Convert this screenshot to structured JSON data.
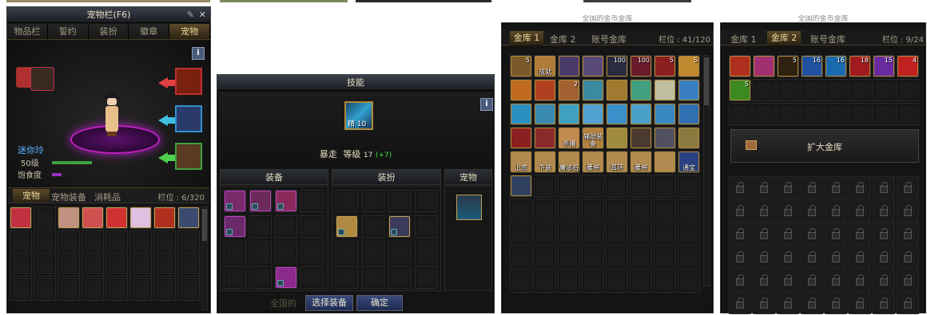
{
  "pet_window": {
    "title": "宠物栏(F6)",
    "tabs": [
      "物品栏",
      "誓约",
      "装扮",
      "徽章",
      "宠物"
    ],
    "active_tab": 4,
    "info": "i",
    "pet_name": "迷你玲",
    "level": "50级",
    "satiety_label": "饱食度",
    "subtabs": [
      "宠物",
      "宠物装备",
      "消耗品"
    ],
    "capacity": "栏位 : 6/320"
  },
  "skill_window": {
    "title": "技能",
    "info": "i",
    "skill_label": "精 10",
    "skill_line": {
      "name": "暴走",
      "level_label": "等级",
      "level": "17",
      "bonus": "(+7)"
    },
    "sections": [
      "装备",
      "装扮",
      "宠物"
    ],
    "select_button": "选择装备",
    "confirm_button": "确定",
    "bg_text": "全国的"
  },
  "vault1": {
    "title": "全国的金币金库",
    "tabs": [
      "金库 1",
      "金库 2",
      "账号金库"
    ],
    "active_tab": 0,
    "capacity": "栏位 : 41/120",
    "items": [
      {
        "c": "#7a5a2a",
        "n": "5",
        "t": ""
      },
      {
        "c": "#b07a3a",
        "n": "",
        "t": "成就"
      },
      {
        "c": "#4a3a6a",
        "n": "",
        "t": ""
      },
      {
        "c": "#5a4a7a",
        "n": "",
        "t": ""
      },
      {
        "c": "#2a2a40",
        "n": "100",
        "t": ""
      },
      {
        "c": "#6a1a2a",
        "n": "100",
        "t": ""
      },
      {
        "c": "#8a2020",
        "n": "5",
        "t": ""
      },
      {
        "c": "#c08a30",
        "n": "5",
        "t": ""
      },
      {
        "c": "#c06a20",
        "n": "",
        "t": ""
      },
      {
        "c": "#b04020",
        "n": "",
        "t": ""
      },
      {
        "c": "#a06030",
        "n": "2",
        "t": ""
      },
      {
        "c": "#3a8aa0",
        "n": "",
        "t": ""
      },
      {
        "c": "#a07a30",
        "n": "",
        "t": ""
      },
      {
        "c": "#40a080",
        "n": "",
        "t": ""
      },
      {
        "c": "#c0c0a0",
        "n": "",
        "t": ""
      },
      {
        "c": "#3a80c0",
        "n": "",
        "t": ""
      },
      {
        "c": "#2a90c0",
        "n": "",
        "t": ""
      },
      {
        "c": "#3a8ab0",
        "n": "",
        "t": ""
      },
      {
        "c": "#40a0c0",
        "n": "",
        "t": ""
      },
      {
        "c": "#50a0d0",
        "n": "",
        "t": ""
      },
      {
        "c": "#3a90c8",
        "n": "",
        "t": ""
      },
      {
        "c": "#4aa0c8",
        "n": "",
        "t": ""
      },
      {
        "c": "#3a88c0",
        "n": "",
        "t": ""
      },
      {
        "c": "#3070b0",
        "n": "",
        "t": ""
      },
      {
        "c": "#8a2020",
        "n": "",
        "t": ""
      },
      {
        "c": "#8a2a2a",
        "n": "",
        "t": ""
      },
      {
        "c": "#c08a50",
        "n": "",
        "t": "手镯"
      },
      {
        "c": "#b08040",
        "n": "",
        "t": "辅助装备"
      },
      {
        "c": "#a08a40",
        "n": "",
        "t": ""
      },
      {
        "c": "#4a3a30",
        "n": "",
        "t": ""
      },
      {
        "c": "#505060",
        "n": "",
        "t": ""
      },
      {
        "c": "#8a7a40",
        "n": "",
        "t": ""
      },
      {
        "c": "#b08a50",
        "n": "",
        "t": "上衣"
      },
      {
        "c": "#b08a50",
        "n": "",
        "t": "下装"
      },
      {
        "c": "#b08a50",
        "n": "",
        "t": "魔法石"
      },
      {
        "c": "#b08a50",
        "n": "",
        "t": "腰带"
      },
      {
        "c": "#b08a50",
        "n": "",
        "t": "耳环"
      },
      {
        "c": "#b08a50",
        "n": "",
        "t": "腰带"
      },
      {
        "c": "#b08a50",
        "n": "",
        "t": ""
      },
      {
        "c": "#2a4080",
        "n": "",
        "t": "通宝"
      },
      {
        "c": "#304060",
        "n": "",
        "t": ""
      }
    ]
  },
  "vault2": {
    "title": "全国的金币金库",
    "tabs": [
      "金库 1",
      "金库 2",
      "账号金库"
    ],
    "active_tab": 1,
    "capacity": "栏位 : 9/24",
    "expand_button": "扩大金库",
    "items": [
      {
        "c": "#b03020",
        "n": "",
        "t": ""
      },
      {
        "c": "#a03070",
        "n": "",
        "t": ""
      },
      {
        "c": "#302010",
        "n": "5",
        "t": ""
      },
      {
        "c": "#2050a0",
        "n": "16",
        "t": ""
      },
      {
        "c": "#1a6ab0",
        "n": "16",
        "t": ""
      },
      {
        "c": "#a01a20",
        "n": "18",
        "t": ""
      },
      {
        "c": "#6a2aa0",
        "n": "15",
        "t": ""
      },
      {
        "c": "#c02020",
        "n": "4",
        "t": ""
      },
      {
        "c": "#3a8a20",
        "n": "5",
        "t": ""
      }
    ]
  }
}
